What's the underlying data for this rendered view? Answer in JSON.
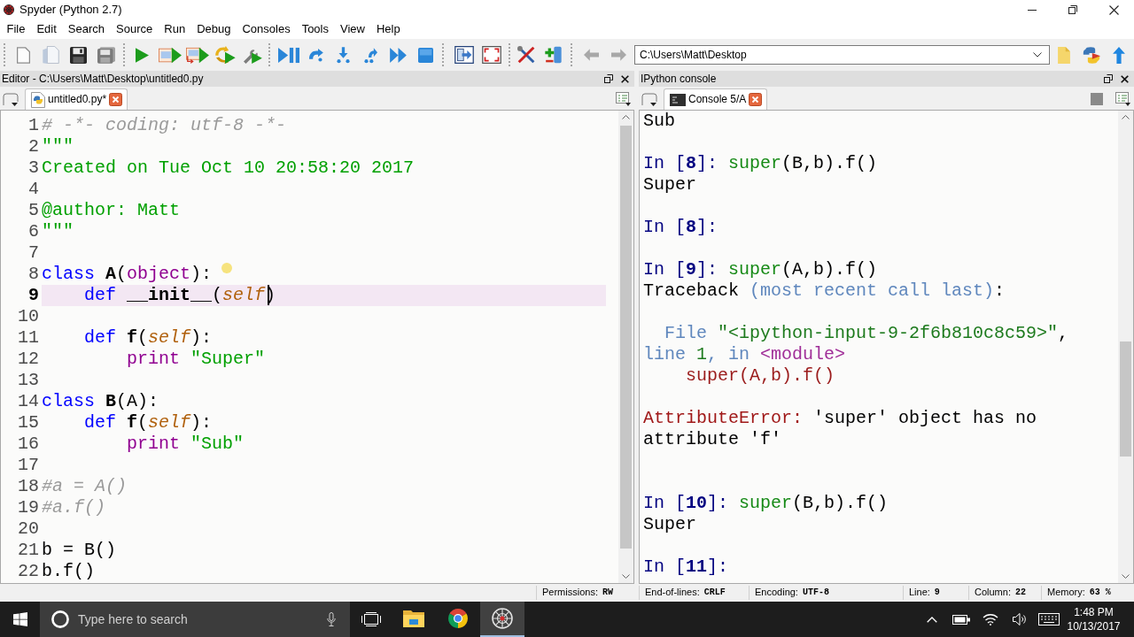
{
  "window": {
    "title": "Spyder (Python 2.7)"
  },
  "menu": [
    "File",
    "Edit",
    "Search",
    "Source",
    "Run",
    "Debug",
    "Consoles",
    "Tools",
    "View",
    "Help"
  ],
  "toolbar": {
    "working_directory": "C:\\Users\\Matt\\Desktop"
  },
  "editor": {
    "title": "Editor - C:\\Users\\Matt\\Desktop\\untitled0.py",
    "tabs": [
      {
        "label": "untitled0.py*",
        "selected": true
      }
    ],
    "lines": [
      {
        "number": "1",
        "current": false,
        "tokens": [
          {
            "kind": "comment",
            "text": "# -*- coding: utf-8 -*-"
          }
        ]
      },
      {
        "number": "2",
        "current": false,
        "tokens": [
          {
            "kind": "string",
            "text": "\"\"\""
          }
        ]
      },
      {
        "number": "3",
        "current": false,
        "tokens": [
          {
            "kind": "string",
            "text": "Created on Tue Oct 10 20:58:20 2017"
          }
        ]
      },
      {
        "number": "4",
        "current": false
      },
      {
        "number": "5",
        "current": false,
        "tokens": [
          {
            "kind": "string",
            "text": "@author: Matt"
          }
        ]
      },
      {
        "number": "6",
        "current": false,
        "tokens": [
          {
            "kind": "string",
            "text": "\"\"\""
          }
        ]
      },
      {
        "number": "7",
        "current": false
      },
      {
        "number": "8",
        "current": false,
        "tokens": [
          {
            "kind": "keyword",
            "text": "class"
          },
          {
            "kind": "definition",
            "text": " A"
          },
          {
            "kind": "plain",
            "text": "("
          },
          {
            "kind": "builtin",
            "text": "object"
          },
          {
            "kind": "plain",
            "text": "):"
          }
        ]
      },
      {
        "number": "9",
        "current": true,
        "tokens": [
          {
            "kind": "keyword",
            "text": "    def"
          },
          {
            "kind": "definition",
            "text": " __init__"
          },
          {
            "kind": "plain",
            "text": "("
          },
          {
            "kind": "self",
            "text": "self",
            "caret": true
          },
          {
            "kind": "plain",
            "text": ")"
          }
        ]
      },
      {
        "number": "10",
        "current": false
      },
      {
        "number": "11",
        "current": false,
        "tokens": [
          {
            "kind": "keyword",
            "text": "    def"
          },
          {
            "kind": "definition",
            "text": " f"
          },
          {
            "kind": "plain",
            "text": "("
          },
          {
            "kind": "self",
            "text": "self"
          },
          {
            "kind": "plain",
            "text": "):"
          }
        ]
      },
      {
        "number": "12",
        "current": false,
        "tokens": [
          {
            "kind": "builtin",
            "text": "        print"
          },
          {
            "kind": "string",
            "text": " \"Super\""
          }
        ]
      },
      {
        "number": "13",
        "current": false
      },
      {
        "number": "14",
        "current": false,
        "tokens": [
          {
            "kind": "keyword",
            "text": "class"
          },
          {
            "kind": "definition",
            "text": " B"
          },
          {
            "kind": "plain",
            "text": "(A):"
          }
        ]
      },
      {
        "number": "15",
        "current": false,
        "tokens": [
          {
            "kind": "keyword",
            "text": "    def"
          },
          {
            "kind": "definition",
            "text": " f"
          },
          {
            "kind": "plain",
            "text": "("
          },
          {
            "kind": "self",
            "text": "self"
          },
          {
            "kind": "plain",
            "text": "):"
          }
        ]
      },
      {
        "number": "16",
        "current": false,
        "tokens": [
          {
            "kind": "builtin",
            "text": "        print"
          },
          {
            "kind": "string",
            "text": " \"Sub\""
          }
        ]
      },
      {
        "number": "17",
        "current": false
      },
      {
        "number": "18",
        "current": false,
        "tokens": [
          {
            "kind": "comment",
            "text": "#a = A()"
          }
        ]
      },
      {
        "number": "19",
        "current": false,
        "tokens": [
          {
            "kind": "comment",
            "text": "#a.f()"
          }
        ]
      },
      {
        "number": "20",
        "current": false
      },
      {
        "number": "21",
        "current": false,
        "tokens": [
          {
            "kind": "plain",
            "text": "b = B()"
          }
        ]
      },
      {
        "number": "22",
        "current": false,
        "tokens": [
          {
            "kind": "plain",
            "text": "b.f()"
          }
        ]
      }
    ]
  },
  "console": {
    "title": "IPython console",
    "tabs": [
      {
        "label": "Console 5/A",
        "selected": true
      }
    ],
    "lines": [
      {
        "kind": "text",
        "tokens": [
          {
            "kind": "plain",
            "text": "Sub"
          }
        ]
      },
      {
        "kind": "blank"
      },
      {
        "kind": "text",
        "tokens": [
          {
            "kind": "prompt",
            "text": "In ["
          },
          {
            "kind": "prompt_number",
            "text": "8"
          },
          {
            "kind": "prompt",
            "text": "]: "
          },
          {
            "kind": "call",
            "text": "super"
          },
          {
            "kind": "plain",
            "text": "(B,b).f()"
          }
        ]
      },
      {
        "kind": "text",
        "tokens": [
          {
            "kind": "plain",
            "text": "Super"
          }
        ]
      },
      {
        "kind": "blank"
      },
      {
        "kind": "text",
        "tokens": [
          {
            "kind": "prompt",
            "text": "In ["
          },
          {
            "kind": "prompt_number",
            "text": "8"
          },
          {
            "kind": "prompt",
            "text": "]:"
          }
        ]
      },
      {
        "kind": "blank"
      },
      {
        "kind": "text",
        "tokens": [
          {
            "kind": "prompt",
            "text": "In ["
          },
          {
            "kind": "prompt_number",
            "text": "9"
          },
          {
            "kind": "prompt",
            "text": "]: "
          },
          {
            "kind": "call",
            "text": "super"
          },
          {
            "kind": "plain",
            "text": "(A,b).f()"
          }
        ]
      },
      {
        "kind": "text",
        "tokens": [
          {
            "kind": "plain",
            "text": "Traceback "
          },
          {
            "kind": "trace_note",
            "text": "(most recent call last)"
          },
          {
            "kind": "plain",
            "text": ":"
          }
        ]
      },
      {
        "kind": "blank"
      },
      {
        "kind": "text",
        "tokens": [
          {
            "kind": "trace_note",
            "text": "  File "
          },
          {
            "kind": "trace_string",
            "text": "\"<ipython-input-9-2f6b810c8c59>\""
          },
          {
            "kind": "plain",
            "text": ","
          }
        ]
      },
      {
        "kind": "text",
        "tokens": [
          {
            "kind": "trace_note",
            "text": "line "
          },
          {
            "kind": "trace_string",
            "text": "1"
          },
          {
            "kind": "trace_note",
            "text": ", in "
          },
          {
            "kind": "trace_module",
            "text": "<module>"
          }
        ]
      },
      {
        "kind": "text",
        "tokens": [
          {
            "kind": "trace_code",
            "text": "    super(A,b).f()"
          }
        ]
      },
      {
        "kind": "blank"
      },
      {
        "kind": "text",
        "tokens": [
          {
            "kind": "error",
            "text": "AttributeError:"
          },
          {
            "kind": "plain",
            "text": " 'super' object has no"
          }
        ]
      },
      {
        "kind": "text",
        "tokens": [
          {
            "kind": "plain",
            "text": "attribute 'f'"
          }
        ]
      },
      {
        "kind": "blank"
      },
      {
        "kind": "blank"
      },
      {
        "kind": "text",
        "tokens": [
          {
            "kind": "prompt",
            "text": "In ["
          },
          {
            "kind": "prompt_number",
            "text": "10"
          },
          {
            "kind": "prompt",
            "text": "]: "
          },
          {
            "kind": "call",
            "text": "super"
          },
          {
            "kind": "plain",
            "text": "(B,b).f()"
          }
        ]
      },
      {
        "kind": "text",
        "tokens": [
          {
            "kind": "plain",
            "text": "Super"
          }
        ]
      },
      {
        "kind": "blank"
      },
      {
        "kind": "text",
        "tokens": [
          {
            "kind": "prompt",
            "text": "In ["
          },
          {
            "kind": "prompt_number",
            "text": "11"
          },
          {
            "kind": "prompt",
            "text": "]:"
          }
        ]
      }
    ]
  },
  "status_bar": [
    {
      "label": "Permissions:",
      "value": "RW"
    },
    {
      "label": "End-of-lines:",
      "value": "CRLF"
    },
    {
      "label": "Encoding:",
      "value": "UTF-8"
    },
    {
      "label": "Line:",
      "value": "9"
    },
    {
      "label": "Column:",
      "value": "22"
    },
    {
      "label": "Memory:",
      "value": "63 %"
    }
  ],
  "taskbar": {
    "search": {
      "placeholder": "Type here to search"
    },
    "apps": [
      {
        "selected": false
      },
      {
        "selected": false
      },
      {
        "selected": true
      }
    ],
    "clock": {
      "time": "1:48 PM",
      "date": "10/13/2017"
    }
  }
}
